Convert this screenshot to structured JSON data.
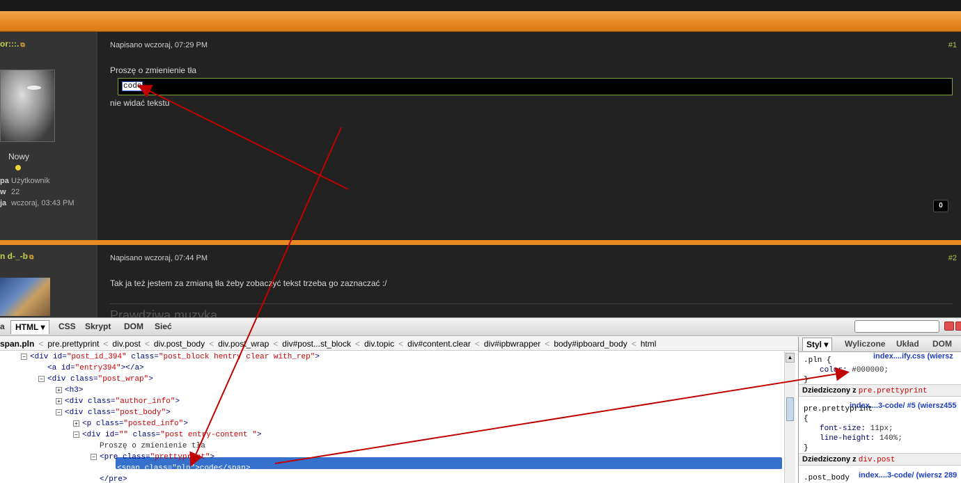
{
  "posts": [
    {
      "author": "or:::.",
      "posted": "Napisano wczoraj, 07:29 PM",
      "number": "#1",
      "text": "Proszę o zmienienie tła",
      "code": "code",
      "after": "nie widać tekstu",
      "rank": "Nowy",
      "stats": [
        {
          "label": "pa",
          "value": "Użytkownik"
        },
        {
          "label": "w",
          "value": "22"
        },
        {
          "label": "ja",
          "value": "wczoraj, 03:43 PM"
        }
      ],
      "reputation": "0"
    },
    {
      "author": "n d-_-b",
      "posted": "Napisano wczoraj, 07:44 PM",
      "number": "#2",
      "text": "Tak ja też jestem za zmianą tła żeby zobaczyć tekst trzeba go zaznaczać :/",
      "signature": "Prawdziwa muzyka"
    }
  ],
  "firebug": {
    "tabs": [
      "a",
      "HTML ▾",
      "CSS",
      "Skrypt",
      "DOM",
      "Sieć"
    ],
    "breadcrumbs": [
      "span.pln",
      "pre.prettyprint",
      "div.post",
      "div.post_body",
      "div.post_wrap",
      "div#post...st_block",
      "div.topic",
      "div#content.clear",
      "div#ipbwrapper",
      "body#ipboard_body",
      "html"
    ],
    "tree": [
      {
        "tag": "<div ",
        "attr": "id=",
        "val": "\"post_id_394\"",
        "attr2": " class=",
        "val2": "\"post_block hentry clear with_rep\"",
        "end": ">"
      },
      {
        "tag": "<a ",
        "attr": "id=",
        "val": "\"entry394\"",
        "end": "></a>"
      },
      {
        "tag": "<div ",
        "attr": "class=",
        "val": "\"post_wrap\"",
        "end": ">"
      },
      {
        "tag": "<h3>"
      },
      {
        "tag": "<div ",
        "attr": "class=",
        "val": "\"author_info\"",
        "end": ">"
      },
      {
        "tag": "<div ",
        "attr": "class=",
        "val": "\"post_body\"",
        "end": ">"
      },
      {
        "tag": "<p ",
        "attr": "class=",
        "val": "\"posted_info\"",
        "end": ">"
      },
      {
        "tag": "<div ",
        "attr": "id=",
        "val": "\"\"",
        "attr2": " class=",
        "val2": "\"post entry-content \"",
        "end": ">"
      },
      {
        "text": "Proszę o zmienienie tła"
      },
      {
        "tag": "<pre ",
        "attr": "class=",
        "val": "\"prettyprint\"",
        "end": ">"
      },
      {
        "tag": "<span ",
        "attr": "class=",
        "val": "\"pln\"",
        "end": ">",
        "text2": "code",
        "close": "</span>"
      },
      {
        "tag": "</pre>"
      }
    ],
    "side_tabs": [
      "Styl ▾",
      "Wyliczone",
      "Układ",
      "DOM"
    ],
    "rules": {
      "r1_sel": ".pln {",
      "r1_src": "index....ify.css (wiersz",
      "r1_prop": "color:",
      "r1_val": "#000000;",
      "r1_close": "}",
      "inh1_label": "Dziedziczony z",
      "inh1_sel": "pre.prettyprint",
      "r2_src": "index....3-code/ #5 (wiersz455",
      "r2_sel": "pre.prettyprint",
      "r2_open": "{",
      "r2_p1": "font-size:",
      "r2_v1": "11px;",
      "r2_p2": "line-height:",
      "r2_v2": "140%;",
      "r2_close": "}",
      "inh2_label": "Dziedziczony z",
      "inh2_sel": "div.post",
      "r3_sel": ".post_body",
      "r3_src": "index....3-code/ (wiersz 289"
    }
  }
}
